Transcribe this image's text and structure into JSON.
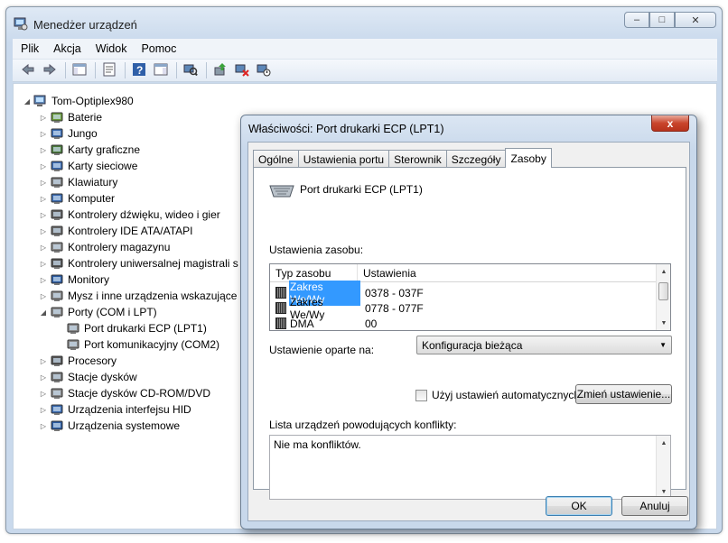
{
  "window": {
    "title": "Menedżer urządzeń",
    "minimize": "–",
    "maximize": "□",
    "close": "✕"
  },
  "menu": [
    "Plik",
    "Akcja",
    "Widok",
    "Pomoc"
  ],
  "toolbar": [
    "back-icon",
    "forward-icon",
    "sep",
    "show-hide-console-tree-icon",
    "sep",
    "properties-icon",
    "sep",
    "help-icon",
    "action-pane-icon",
    "sep",
    "scan-hardware-icon",
    "sep",
    "update-driver-icon",
    "uninstall-icon",
    "disable-icon"
  ],
  "tree": {
    "root": "Tom-Optiplex980",
    "items": [
      {
        "label": "Baterie",
        "icon": "battery-icon"
      },
      {
        "label": "Jungo",
        "icon": "usb-device-icon"
      },
      {
        "label": "Karty graficzne",
        "icon": "display-adapter-icon"
      },
      {
        "label": "Karty sieciowe",
        "icon": "network-adapter-icon"
      },
      {
        "label": "Klawiatury",
        "icon": "keyboard-icon"
      },
      {
        "label": "Komputer",
        "icon": "computer-icon"
      },
      {
        "label": "Kontrolery dźwięku, wideo i gier",
        "icon": "speaker-icon"
      },
      {
        "label": "Kontrolery IDE ATA/ATAPI",
        "icon": "ide-controller-icon"
      },
      {
        "label": "Kontrolery magazynu",
        "icon": "storage-controller-icon"
      },
      {
        "label": "Kontrolery uniwersalnej magistrali s",
        "icon": "usb-icon"
      },
      {
        "label": "Monitory",
        "icon": "monitor-icon"
      },
      {
        "label": "Mysz i inne urządzenia wskazujące",
        "icon": "mouse-icon"
      },
      {
        "label": "Porty (COM i LPT)",
        "icon": "port-icon",
        "expanded": true
      },
      {
        "label": "Port drukarki ECP (LPT1)",
        "icon": "port-icon",
        "child": true
      },
      {
        "label": "Port komunikacyjny (COM2)",
        "icon": "port-icon",
        "child": true
      },
      {
        "label": "Procesory",
        "icon": "processor-icon"
      },
      {
        "label": "Stacje dysków",
        "icon": "disk-drive-icon"
      },
      {
        "label": "Stacje dysków CD-ROM/DVD",
        "icon": "cdrom-icon"
      },
      {
        "label": "Urządzenia interfejsu HID",
        "icon": "hid-icon"
      },
      {
        "label": "Urządzenia systemowe",
        "icon": "system-device-icon"
      }
    ]
  },
  "dialog": {
    "title": "Właściwości: Port drukarki ECP (LPT1)",
    "close": "x",
    "tabs": [
      "Ogólne",
      "Ustawienia portu",
      "Sterownik",
      "Szczegóły",
      "Zasoby"
    ],
    "active_tab": "Zasoby",
    "device_name": "Port drukarki ECP (LPT1)",
    "resource_settings_label": "Ustawienia zasobu:",
    "columns": [
      "Typ zasobu",
      "Ustawienia"
    ],
    "rows": [
      {
        "type": "Zakres We/Wy",
        "setting": "0378 - 037F",
        "selected": true
      },
      {
        "type": "Zakres We/Wy",
        "setting": "0778 - 077F"
      },
      {
        "type": "DMA",
        "setting": "00"
      }
    ],
    "based_on_label": "Ustawienie oparte na:",
    "based_on_value": "Konfiguracja bieżąca",
    "auto_checkbox_label": "Użyj ustawień automatycznych",
    "auto_checked": false,
    "change_button": "Zmień ustawienie...",
    "conflict_label": "Lista urządzeń powodujących konflikty:",
    "conflict_text": "Nie ma konfliktów.",
    "ok": "OK",
    "cancel": "Anuluj"
  }
}
